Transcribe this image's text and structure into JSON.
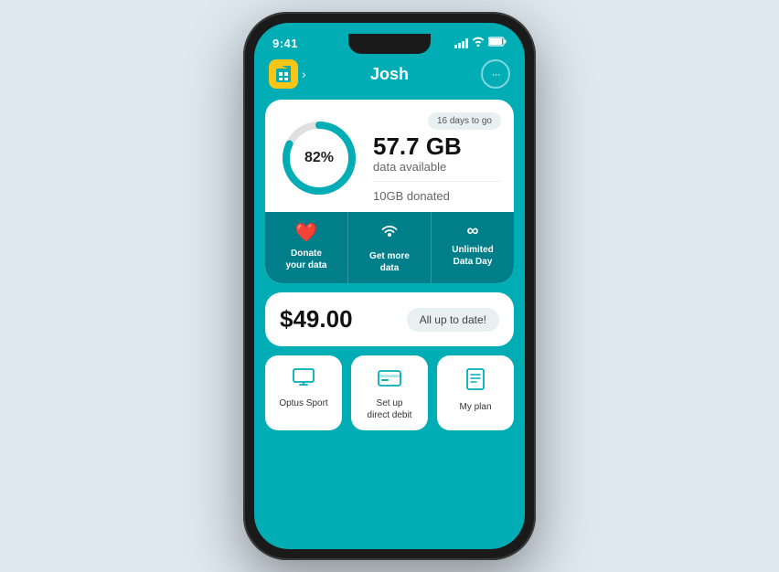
{
  "status_bar": {
    "time": "9:41"
  },
  "header": {
    "user_name": "Josh",
    "sim_icon": "📱",
    "chat_icon": "···"
  },
  "data_card": {
    "days_badge": "16 days to go",
    "percentage": "82%",
    "donut_filled": 82,
    "gb_available": "57.7 GB",
    "available_label": "data available",
    "donated_label": "10GB donated",
    "actions": [
      {
        "id": "donate",
        "icon": "❤️",
        "label": "Donate\nyour data"
      },
      {
        "id": "get_more",
        "icon": "📶",
        "label": "Get more\ndata"
      },
      {
        "id": "unlimited",
        "icon": "∞",
        "label": "Unlimited\nData Day"
      }
    ]
  },
  "bill_card": {
    "amount": "$49.00",
    "status": "All up to date!"
  },
  "tiles": [
    {
      "id": "optus_sport",
      "icon": "🖥",
      "label": "Optus Sport"
    },
    {
      "id": "direct_debit",
      "icon": "💳",
      "label": "Set up\ndirect debit"
    },
    {
      "id": "my_plan",
      "icon": "📋",
      "label": "My plan"
    }
  ],
  "colors": {
    "teal": "#00adb5",
    "dark_teal": "#007f8a",
    "yellow": "#f5c518",
    "white": "#ffffff",
    "light_bg": "#e8f0f2"
  }
}
